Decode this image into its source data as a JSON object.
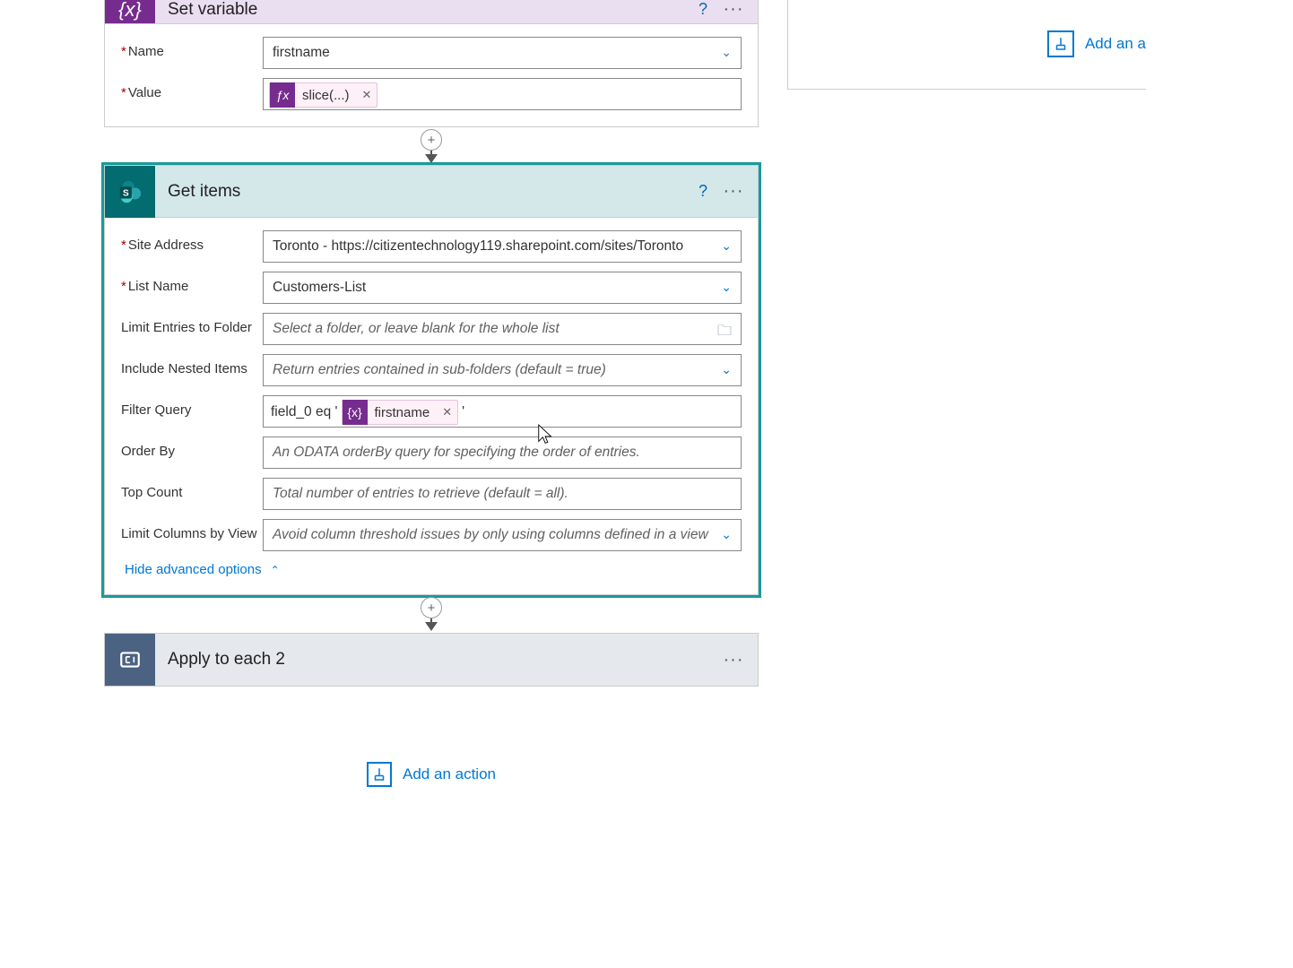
{
  "setVariable": {
    "title": "Set variable",
    "nameLabel": "Name",
    "nameValue": "firstname",
    "valueLabel": "Value",
    "tokenLabel": "slice(...)"
  },
  "getItems": {
    "title": "Get items",
    "siteLabel": "Site Address",
    "siteValue": "Toronto - https://citizentechnology119.sharepoint.com/sites/Toronto",
    "listLabel": "List Name",
    "listValue": "Customers-List",
    "limitFolderLabel": "Limit Entries to Folder",
    "limitFolderPlaceholder": "Select a folder, or leave blank for the whole list",
    "nestedLabel": "Include Nested Items",
    "nestedPlaceholder": "Return entries contained in sub-folders (default = true)",
    "filterLabel": "Filter Query",
    "filterPrefix": "field_0 eq '",
    "filterToken": "firstname",
    "filterSuffix": "'",
    "orderByLabel": "Order By",
    "orderByPlaceholder": "An ODATA orderBy query for specifying the order of entries.",
    "topCountLabel": "Top Count",
    "topCountPlaceholder": "Total number of entries to retrieve (default = all).",
    "limitColsLabel": "Limit Columns by View",
    "limitColsPlaceholder": "Avoid column threshold issues by only using columns defined in a view",
    "hideAdvanced": "Hide advanced options"
  },
  "applyEach": {
    "title": "Apply to each 2"
  },
  "addAction": "Add an action",
  "addAn": "Add an a"
}
